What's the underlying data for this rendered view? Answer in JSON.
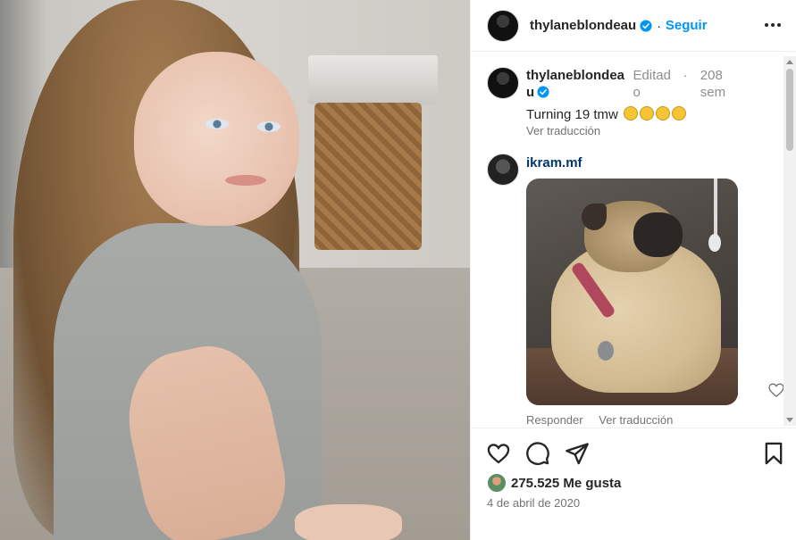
{
  "post": {
    "username": "thylaneblondeau",
    "follow_label": "Seguir",
    "separator": "·"
  },
  "caption": {
    "username": "thylaneblondeau",
    "edited": "Editado",
    "time_ago": "208 sem",
    "separator": "·",
    "text": "Turning 19 tmw",
    "emojis": [
      "grinning-sweat-emoji",
      "grinning-sweat-emoji",
      "pleading-emoji",
      "pleading-emoji"
    ],
    "translate_label": "Ver traducción"
  },
  "comment": {
    "username": "ikram.mf",
    "reply_label": "Responder",
    "translate_label": "Ver traducción"
  },
  "footer": {
    "likes": "275.525 Me gusta",
    "date": "4 de abril de 2020"
  },
  "colors": {
    "accent": "#0095f6",
    "text": "#262626",
    "muted": "#737373",
    "link": "#00376b"
  },
  "icons": {
    "verified": "verified-badge-icon",
    "more": "more-options-icon",
    "like": "heart-icon",
    "comment": "comment-icon",
    "share": "send-icon",
    "save": "bookmark-icon"
  }
}
